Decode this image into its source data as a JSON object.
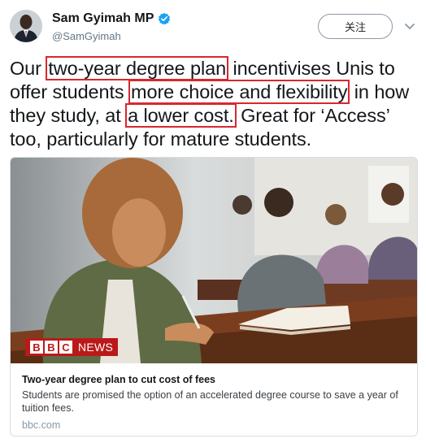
{
  "author": {
    "name": "Sam Gyimah MP",
    "handle": "@SamGyimah",
    "verified": true
  },
  "follow_button": {
    "label": "关注"
  },
  "tweet": {
    "segments": [
      {
        "text": "Our ",
        "highlighted": false
      },
      {
        "text": "two-year degree plan",
        "highlighted": true
      },
      {
        "text": " incentivises Unis to offer students ",
        "highlighted": false
      },
      {
        "text": "more choice and flexibility",
        "highlighted": true
      },
      {
        "text": " in how they study, at ",
        "highlighted": false
      },
      {
        "text": "a lower cost.",
        "highlighted": true
      },
      {
        "text": " Great for ‘Access’ too, particularly for mature students.",
        "highlighted": false
      }
    ]
  },
  "card": {
    "logo_letters": [
      "B",
      "B",
      "C"
    ],
    "logo_suffix": "NEWS",
    "title": "Two-year degree plan to cut cost of fees",
    "description": "Students are promised the option of an accelerated degree course to save a year of tuition fees.",
    "domain": "bbc.com"
  },
  "colors": {
    "highlight_border": "#d9272e",
    "bbc_red": "#bb1919",
    "verified_blue": "#1da1f2"
  }
}
